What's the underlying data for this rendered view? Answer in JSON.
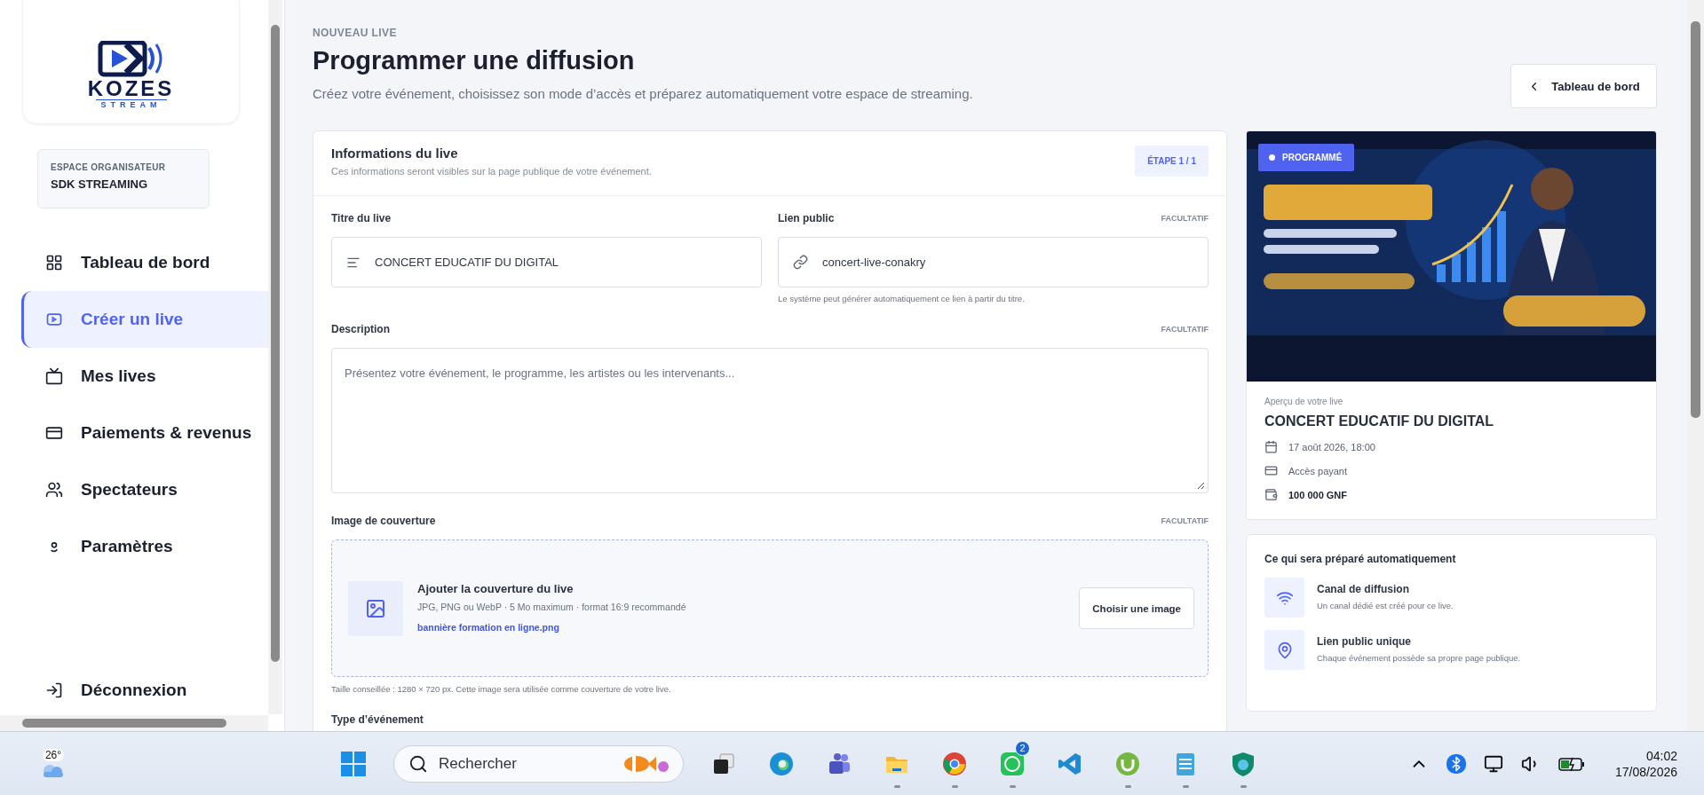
{
  "sidebar": {
    "logo": {
      "name": "KOZES",
      "tagline": "STREAM"
    },
    "workspace": {
      "label": "ESPACE ORGANISATEUR",
      "name": "SDK STREAMING"
    },
    "nav": [
      {
        "label": "Tableau de bord",
        "selected": false
      },
      {
        "label": "Créer un live",
        "selected": true
      },
      {
        "label": "Mes lives",
        "selected": false
      },
      {
        "label": "Paiements & revenus",
        "selected": false
      },
      {
        "label": "Spectateurs",
        "selected": false
      },
      {
        "label": "Paramètres",
        "selected": false
      }
    ],
    "logout": "Déconnexion"
  },
  "header": {
    "eyebrow": "NOUVEAU LIVE",
    "title": "Programmer une diffusion",
    "subtitle": "Créez votre événement, choisissez son mode d’accès et préparez automatiquement votre espace de streaming.",
    "back_button": "Tableau de bord"
  },
  "form": {
    "title": "Informations du live",
    "subtitle": "Ces informations seront visibles sur la page publique de votre événement.",
    "step": "ÉTAPE 1 / 1",
    "title_field": {
      "label": "Titre du live",
      "value": "CONCERT EDUCATIF DU DIGITAL"
    },
    "link_field": {
      "label": "Lien public",
      "optional": "FACULTATIF",
      "value": "concert-live-conakry",
      "help": "Le système peut générer automatiquement ce lien à partir du titre."
    },
    "description": {
      "label": "Description",
      "optional": "FACULTATIF",
      "placeholder": "Présentez votre événement, le programme, les artistes ou les intervenants..."
    },
    "cover": {
      "label": "Image de couverture",
      "optional": "FACULTATIF",
      "title": "Ajouter la couverture du live",
      "spec": "JPG, PNG ou WebP · 5 Mo maximum · format 16:9 recommandé",
      "file": "bannière formation en ligne.png",
      "button": "Choisir une image",
      "hint": "Taille conseillée : 1280 × 720 px. Cette image sera utilisée comme couverture de votre live."
    },
    "event_type": {
      "label": "Type d’événement"
    }
  },
  "preview": {
    "badge": "PROGRAMMÉ",
    "caption": "Aperçu de votre live",
    "title": "CONCERT EDUCATIF DU DIGITAL",
    "details": [
      {
        "text": "17 août 2026, 18:00",
        "strong": false
      },
      {
        "text": "Accès payant",
        "strong": false
      },
      {
        "text": "100 000 GNF",
        "strong": true
      }
    ]
  },
  "auto": {
    "title": "Ce qui sera préparé automatiquement",
    "items": [
      {
        "title": "Canal de diffusion",
        "text": "Un canal dédié est créé pour ce live."
      },
      {
        "title": "Lien public unique",
        "text": "Chaque événement possède sa propre page publique."
      }
    ]
  },
  "taskbar": {
    "weather": "26°",
    "search": {
      "placeholder": "Rechercher"
    },
    "apps": [
      {
        "running": false
      },
      {
        "running": false
      },
      {
        "running": false
      },
      {
        "running": true
      },
      {
        "running": true
      },
      {
        "running": true,
        "badge": "2"
      },
      {
        "running": false
      },
      {
        "running": true
      },
      {
        "running": true
      },
      {
        "running": true
      }
    ],
    "time": "04:02",
    "date": "17/08/2026"
  }
}
